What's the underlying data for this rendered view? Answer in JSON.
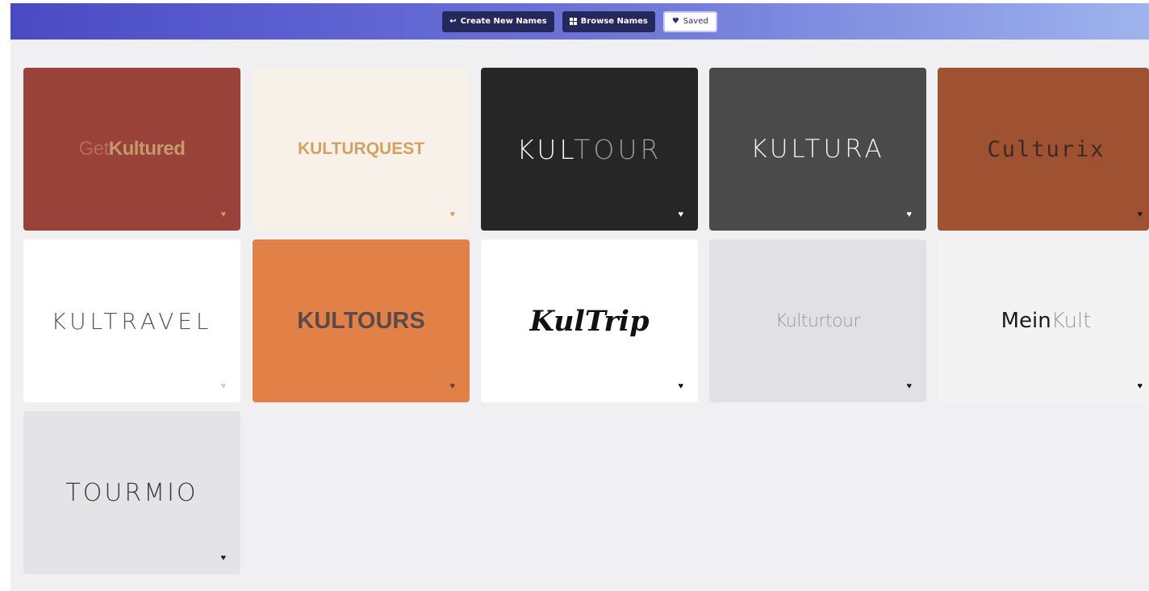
{
  "nav": {
    "create_label": "Create New Names",
    "create_icon": "arrow-return-icon",
    "browse_label": "Browse Names",
    "browse_icon": "grid-icon",
    "saved_label": "Saved",
    "saved_icon": "heart-icon"
  },
  "cards": [
    {
      "name_a": "Get",
      "name_b": "Kultured",
      "bg": "#98423a",
      "saved": true
    },
    {
      "name": "KULTURQUEST",
      "bg": "#f7f1ea",
      "saved": true
    },
    {
      "name_a": "KUL",
      "name_b": "TOUR",
      "bg": "#262626",
      "saved": true
    },
    {
      "name": "KULTURA",
      "bg": "#4a4a4a",
      "saved": true
    },
    {
      "name": "Culturix",
      "bg": "#9e5232",
      "saved": true
    },
    {
      "name": "KULTRAVEL",
      "bg": "#ffffff",
      "saved": true
    },
    {
      "name": "KULTOURS",
      "bg": "#e18148",
      "saved": true
    },
    {
      "name": "KulTrip",
      "bg": "#ffffff",
      "saved": true
    },
    {
      "name": "Kulturtour",
      "bg": "#e1e1e3",
      "saved": true
    },
    {
      "name_a": "Mein",
      "name_b": "Kult",
      "bg": "#f3f3f3",
      "saved": true
    },
    {
      "name": "TOURMIO",
      "bg": "#e4e4e7",
      "saved": true
    }
  ],
  "heart_glyph": "♥"
}
